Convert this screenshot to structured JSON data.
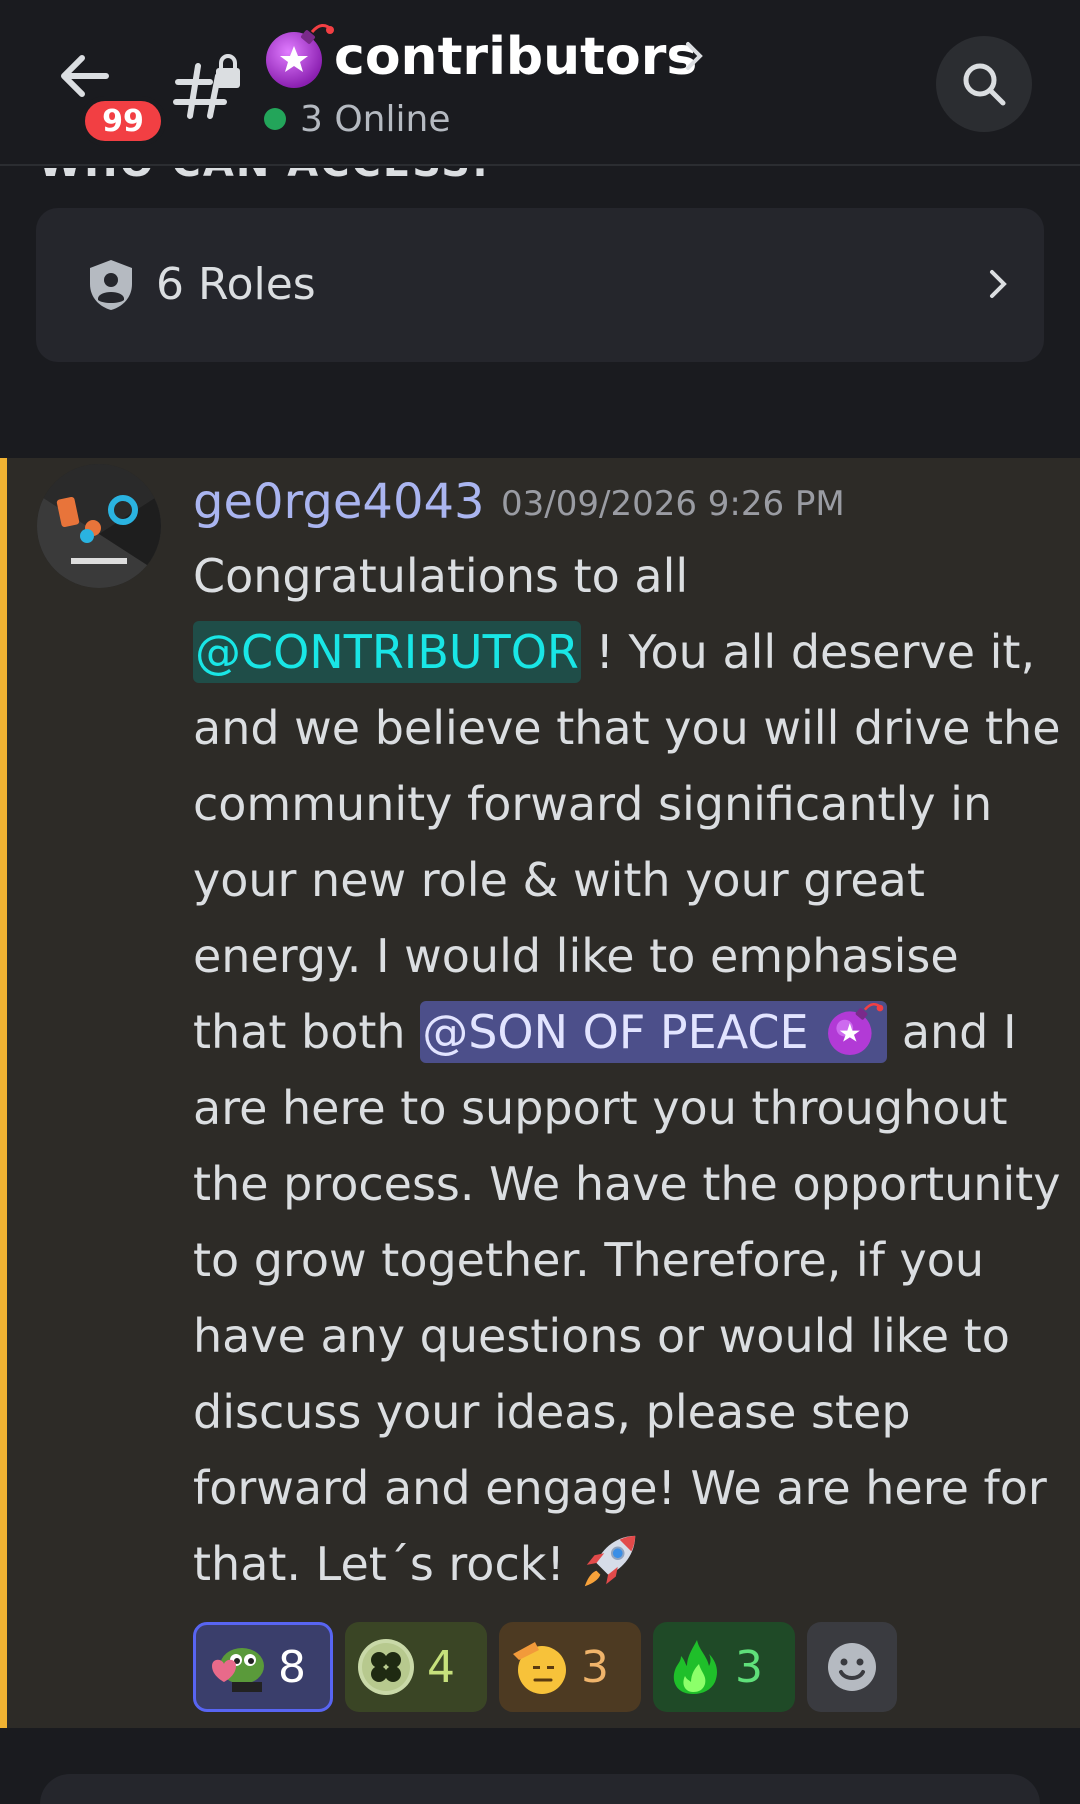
{
  "header": {
    "unread_badge": "99",
    "channel_name": "contributors",
    "online_text": "3 Online",
    "colors": {
      "background": "#1a1b1f",
      "online": "#23a55a",
      "badge": "#f23f43"
    }
  },
  "access": {
    "label": "WHO CAN ACCESS:",
    "roles_text": "6 Roles"
  },
  "message": {
    "author": "ge0rge4043",
    "timestamp": "03/09/2026 9:26 PM",
    "text_1": "Congratulations to all ",
    "mention_1": "@CONTRIBUTOR",
    "text_2": " ! You all deserve it, and we believe that you will drive the community forward significantly in your new role & with your great energy. I would like to emphasise that both ",
    "mention_2": "@SON OF PEACE ",
    "text_3": " and I are here to support you throughout the process. We have the opportunity to grow together. Therefore, if you have any questions or would like to discuss your ideas, please step forward and engage! We are here for that. Let´s rock! ",
    "highlight_color": "#f0b232",
    "reactions": [
      {
        "icon": "pepe-heart-icon",
        "count": "8"
      },
      {
        "icon": "clover-icon",
        "count": "4"
      },
      {
        "icon": "saluting-face-icon",
        "count": "3"
      },
      {
        "icon": "green-flame-icon",
        "count": "3"
      }
    ],
    "add_reaction_icon": "smiley-add-reaction-icon"
  }
}
